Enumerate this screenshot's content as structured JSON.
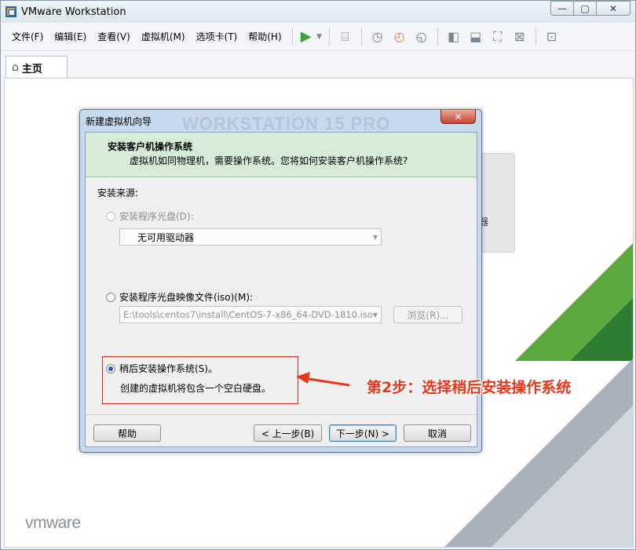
{
  "window": {
    "title": "VMware Workstation",
    "controls": {
      "minimize": "—",
      "maximize": "▢",
      "close": "✕"
    }
  },
  "menu": {
    "items": [
      "文件(F)",
      "编辑(E)",
      "查看(V)",
      "虚拟机(M)",
      "选项卡(T)",
      "帮助(H)"
    ]
  },
  "tabs": [
    {
      "label": "主页",
      "icon": "home-icon"
    }
  ],
  "background": {
    "card_text": "器",
    "logo_text": "vmware",
    "accent_green": "#5aa83e",
    "accent_grey": "#a9b1ba"
  },
  "dialog": {
    "title": "新建虚拟机向导",
    "watermark": "WORKSTATION 15 PRO",
    "close_label": "✕",
    "header": {
      "title": "安装客户机操作系统",
      "description": "虚拟机如同物理机，需要操作系统。您将如何安装客户机操作系统?"
    },
    "source_label": "安装来源:",
    "options": {
      "disc": {
        "label": "安装程序光盘(D):",
        "selected": false,
        "enabled": false,
        "combo_value": "无可用驱动器"
      },
      "iso": {
        "label": "安装程序光盘映像文件(iso)(M):",
        "selected": false,
        "enabled": true,
        "combo_value": "E:\\tools\\centos7\\install\\CentOS-7-x86_64-DVD-1810.iso",
        "browse_label": "浏览(R)..."
      },
      "later": {
        "label": "稍后安装操作系统(S)。",
        "selected": true,
        "description": "创建的虚拟机将包含一个空白硬盘。"
      }
    },
    "buttons": {
      "help": "帮助",
      "back": "< 上一步(B)",
      "next": "下一步(N) >",
      "cancel": "取消"
    }
  },
  "annotation": {
    "text": "第2步：选择稍后安装操作系统",
    "color": "#e8361c"
  }
}
